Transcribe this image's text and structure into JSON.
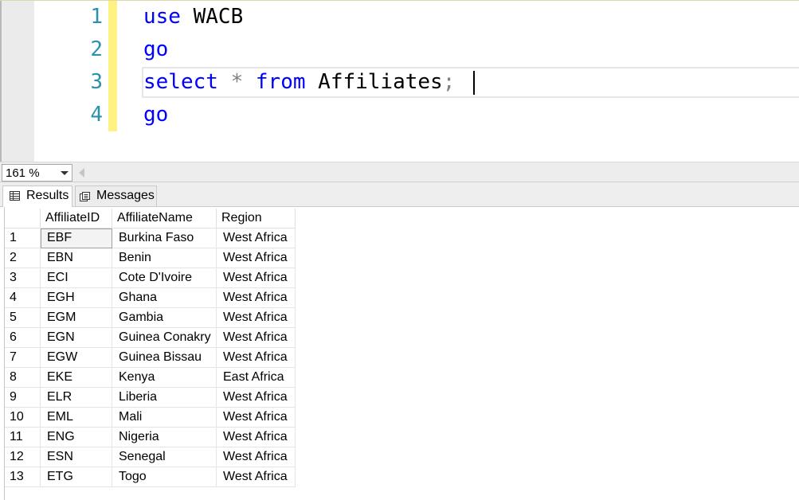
{
  "editor": {
    "line_numbers": [
      "1",
      "2",
      "3",
      "4"
    ],
    "lines": [
      {
        "tokens": [
          {
            "text": "use",
            "kind": "keyword"
          },
          {
            "text": " WACB",
            "kind": "plain"
          }
        ]
      },
      {
        "tokens": [
          {
            "text": "go",
            "kind": "keyword"
          }
        ]
      },
      {
        "tokens": [
          {
            "text": "select",
            "kind": "keyword"
          },
          {
            "text": " ",
            "kind": "plain"
          },
          {
            "text": "*",
            "kind": "operator"
          },
          {
            "text": " ",
            "kind": "plain"
          },
          {
            "text": "from",
            "kind": "keyword"
          },
          {
            "text": " Affiliates",
            "kind": "plain"
          },
          {
            "text": ";",
            "kind": "operator"
          }
        ]
      },
      {
        "tokens": [
          {
            "text": "go",
            "kind": "keyword"
          }
        ]
      }
    ],
    "colors": {
      "keyword": "#0000ff",
      "operator": "#808080",
      "plain": "#000000",
      "line_number": "#2b91af",
      "change_bar": "#fff282"
    }
  },
  "zoom": {
    "value": "161 %"
  },
  "tabs": {
    "results_label": "Results",
    "messages_label": "Messages"
  },
  "grid": {
    "columns": [
      "",
      "AffiliateID",
      "AffiliateName",
      "Region"
    ],
    "rows": [
      [
        "1",
        "EBF",
        "Burkina Faso",
        "West Africa"
      ],
      [
        "2",
        "EBN",
        "Benin",
        "West Africa"
      ],
      [
        "3",
        "ECI",
        "Cote D'Ivoire",
        "West Africa"
      ],
      [
        "4",
        "EGH",
        "Ghana",
        "West Africa"
      ],
      [
        "5",
        "EGM",
        "Gambia",
        "West Africa"
      ],
      [
        "6",
        "EGN",
        "Guinea Conakry",
        "West Africa"
      ],
      [
        "7",
        "EGW",
        "Guinea Bissau",
        "West Africa"
      ],
      [
        "8",
        "EKE",
        "Kenya",
        "East Africa"
      ],
      [
        "9",
        "ELR",
        "Liberia",
        "West Africa"
      ],
      [
        "10",
        "EML",
        "Mali",
        "West Africa"
      ],
      [
        "11",
        "ENG",
        "Nigeria",
        "West Africa"
      ],
      [
        "12",
        "ESN",
        "Senegal",
        "West Africa"
      ],
      [
        "13",
        "ETG",
        "Togo",
        "West Africa"
      ]
    ]
  }
}
